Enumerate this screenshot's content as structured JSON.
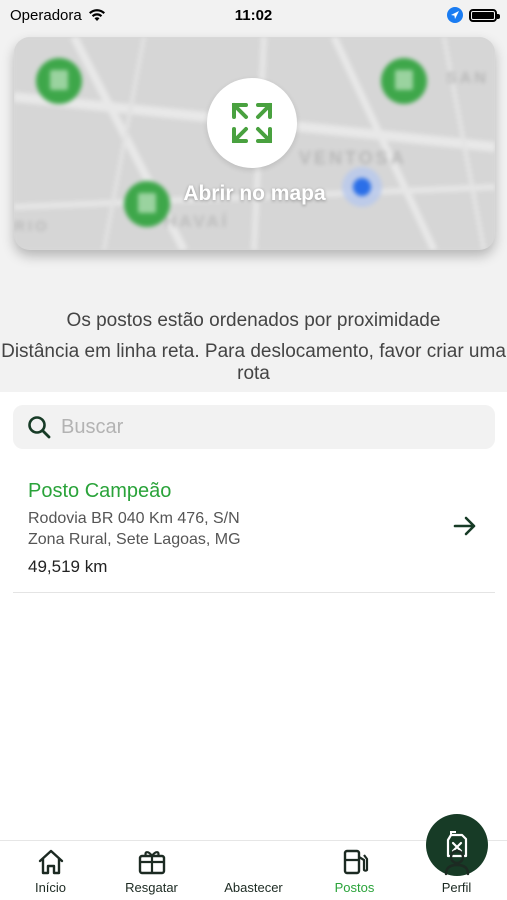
{
  "status_bar": {
    "carrier": "Operadora",
    "time": "11:02"
  },
  "map": {
    "open_label": "Abrir no mapa",
    "icons": [
      "expand-icon",
      "gas-station-marker-icon",
      "location-dot-icon"
    ],
    "street_labels": [
      "VENTOSA",
      "HAVAÍ",
      "RIO",
      "SAN"
    ]
  },
  "info": {
    "line1": "Os postos estão ordenados por proximidade",
    "line2": "Distância em linha reta. Para deslocamento, favor criar uma rota"
  },
  "search": {
    "placeholder": "Buscar",
    "value": ""
  },
  "stations": [
    {
      "name": "Posto Campeão",
      "address_line1": "Rodovia BR 040 Km 476, S/N",
      "address_line2": "Zona Rural, Sete Lagoas, MG",
      "distance": "49,519 km"
    }
  ],
  "tab_bar": {
    "items": [
      {
        "label": "Início",
        "icon": "home-icon"
      },
      {
        "label": "Resgatar",
        "icon": "gift-icon"
      },
      {
        "label": "Abastecer",
        "icon": "fuel-can-icon"
      },
      {
        "label": "Postos",
        "icon": "gas-pump-icon",
        "active": true
      },
      {
        "label": "Perfil",
        "icon": "user-icon"
      }
    ]
  },
  "colors": {
    "brand_green": "#2aa33a",
    "dark_green": "#173b26",
    "background_gray": "#f2f2f2"
  }
}
